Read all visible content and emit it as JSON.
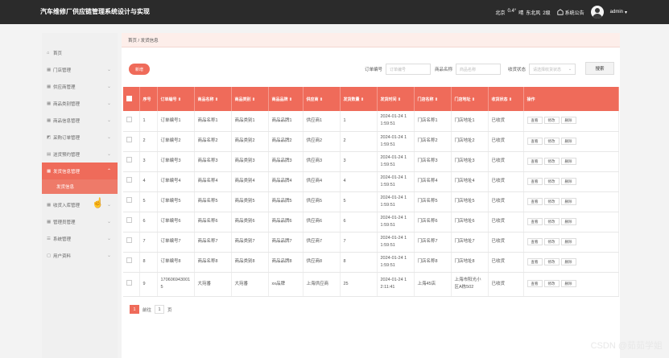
{
  "app": {
    "title": "汽车维修厂供应链管理系统设计与实现"
  },
  "topbar": {
    "weather": [
      "北京",
      "0.4°",
      "晴",
      "东北风",
      "2级"
    ],
    "notice_label": "系统公告",
    "user": "admin",
    "user_chevron": "▾"
  },
  "sidebar": {
    "home": "首页",
    "items": [
      {
        "label": "门店管理"
      },
      {
        "label": "供应商管理"
      },
      {
        "label": "商品类别管理"
      },
      {
        "label": "商品信息管理"
      },
      {
        "label": "采购订单管理"
      },
      {
        "label": "送货预约管理"
      },
      {
        "label": "发货信息管理"
      },
      {
        "label": "收货入库管理"
      },
      {
        "label": "管理员管理"
      },
      {
        "label": "系统管理"
      },
      {
        "label": "用户资料"
      }
    ],
    "sub_active": "发货信息"
  },
  "breadcrumb": "首页 / 发货信息",
  "toolbar": {
    "add_label": "新增",
    "order_no_label": "订单编号",
    "order_no_placeholder": "订单编号",
    "product_name_label": "商品名称",
    "product_name_placeholder": "商品名称",
    "receive_status_label": "收货状态",
    "receive_status_placeholder": "请选择收货状态",
    "search_label": "搜索"
  },
  "table": {
    "columns": [
      "序号",
      "订单编号 ⇕",
      "商品名称 ⇕",
      "商品类别 ⇕",
      "商品品牌 ⇕",
      "供应商 ⇕",
      "发货数量 ⇕",
      "发货时间 ⇕",
      "门店名称 ⇕",
      "门店地址 ⇕",
      "收货状态 ⇕",
      "操作"
    ],
    "op_labels": [
      "查看",
      "修改",
      "删除"
    ],
    "rows": [
      [
        "1",
        "订单编号1",
        "商品名称1",
        "商品类别1",
        "商品品牌1",
        "供应商1",
        "1",
        "2024-01-24 1",
        "1:59:51",
        "门店名称1",
        "门店地址1",
        "已收货"
      ],
      [
        "2",
        "订单编号2",
        "商品名称2",
        "商品类别2",
        "商品品牌2",
        "供应商2",
        "2",
        "2024-01-24 1",
        "1:59:51",
        "门店名称2",
        "门店地址2",
        "已收货"
      ],
      [
        "3",
        "订单编号3",
        "商品名称3",
        "商品类别3",
        "商品品牌3",
        "供应商3",
        "3",
        "2024-01-24 1",
        "1:59:51",
        "门店名称3",
        "门店地址3",
        "已收货"
      ],
      [
        "4",
        "订单编号4",
        "商品名称4",
        "商品类别4",
        "商品品牌4",
        "供应商4",
        "4",
        "2024-01-24 1",
        "1:59:51",
        "门店名称4",
        "门店地址4",
        "已收货"
      ],
      [
        "5",
        "订单编号5",
        "商品名称5",
        "商品类别5",
        "商品品牌5",
        "供应商5",
        "5",
        "2024-01-24 1",
        "1:59:51",
        "门店名称5",
        "门店地址5",
        "已收货"
      ],
      [
        "6",
        "订单编号6",
        "商品名称6",
        "商品类别6",
        "商品品牌6",
        "供应商6",
        "6",
        "2024-01-24 1",
        "1:59:51",
        "门店名称6",
        "门店地址6",
        "已收货"
      ],
      [
        "7",
        "订单编号7",
        "商品名称7",
        "商品类别7",
        "商品品牌7",
        "供应商7",
        "7",
        "2024-01-24 1",
        "1:59:51",
        "门店名称7",
        "门店地址7",
        "已收货"
      ],
      [
        "8",
        "订单编号8",
        "商品名称8",
        "商品类别8",
        "商品品牌8",
        "供应商8",
        "8",
        "2024-01-24 1",
        "1:59:51",
        "门店名称8",
        "门店地址8",
        "已收货"
      ],
      [
        "9",
        "170606943001",
        "5",
        "大宛番",
        "大宛番",
        "xx品牌",
        "上海供应商",
        "25",
        "2024-01-24 1",
        "2:11:41",
        "上海45店",
        "上海市阳光小",
        "区A栋502",
        "已收货"
      ]
    ]
  },
  "pager": {
    "current": "1",
    "goto_label": "前往",
    "goto_value": "1",
    "page_label": "页"
  },
  "watermark": "CSDN @茹茹学姐",
  "colors": {
    "accent": "#ef6b5a",
    "topbar": "#2b2b2b"
  }
}
